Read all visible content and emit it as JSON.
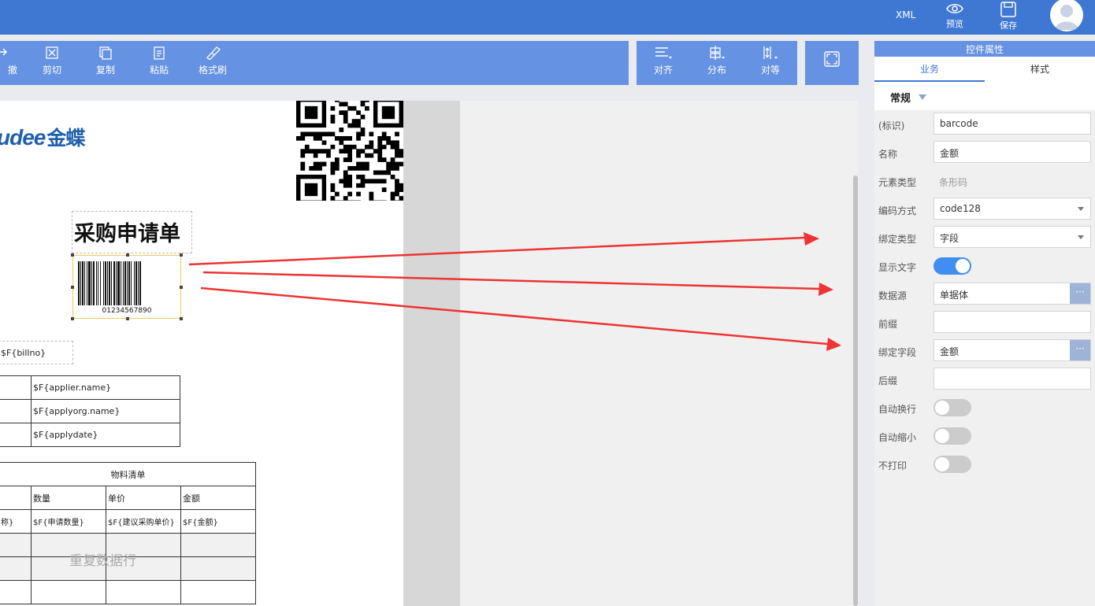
{
  "header": {
    "xml_label": "XML",
    "preview_label": "预览",
    "save_label": "保存"
  },
  "toolbar": {
    "undo_label": "撤",
    "cut_label": "剪切",
    "copy_label": "复制",
    "paste_label": "粘贴",
    "format_painter_label": "格式刷",
    "align_label": "对齐",
    "distribute_label": "分布",
    "equalize_label": "对等"
  },
  "canvas": {
    "logo_text": "udee",
    "logo_cn": "金蝶",
    "report_title": "采购申请单",
    "barcode_number": "01234567890",
    "billno": "$F{billno}",
    "info_rows": [
      "$F{applier.name}",
      "$F{applyorg.name}",
      "$F{applydate}"
    ],
    "material_table": {
      "title": "物料清单",
      "headers": [
        "数量",
        "单价",
        "金额"
      ],
      "data_row": [
        "称}",
        "$F{申请数量}",
        "$F{建议采购单价}",
        "$F{金额}"
      ],
      "repeat_label": "重复数据行"
    }
  },
  "panel": {
    "title": "控件属性",
    "tabs": [
      "业务",
      "样式"
    ],
    "active_tab": "业务",
    "section": "常规",
    "props": {
      "id_label": "(标识)",
      "id_value": "barcode",
      "name_label": "名称",
      "name_value": "金额",
      "type_label": "元素类型",
      "type_value": "条形码",
      "encoding_label": "编码方式",
      "encoding_value": "code128",
      "bind_type_label": "绑定类型",
      "bind_type_value": "字段",
      "show_text_label": "显示文字",
      "show_text_on": true,
      "datasource_label": "数据源",
      "datasource_value": "单据体",
      "prefix_label": "前缀",
      "prefix_value": "",
      "bind_field_label": "绑定字段",
      "bind_field_value": "金额",
      "suffix_label": "后缀",
      "suffix_value": "",
      "autowrap_label": "自动换行",
      "autowrap_on": false,
      "autoshrink_label": "自动缩小",
      "autoshrink_on": false,
      "noprint_label": "不打印",
      "noprint_on": false,
      "dots_label": "···"
    }
  },
  "colors": {
    "topbar": "#3f78d3",
    "toolbar": "#6592e2",
    "arrow": "#ee3333",
    "toggle_on": "#3f8ef0"
  }
}
